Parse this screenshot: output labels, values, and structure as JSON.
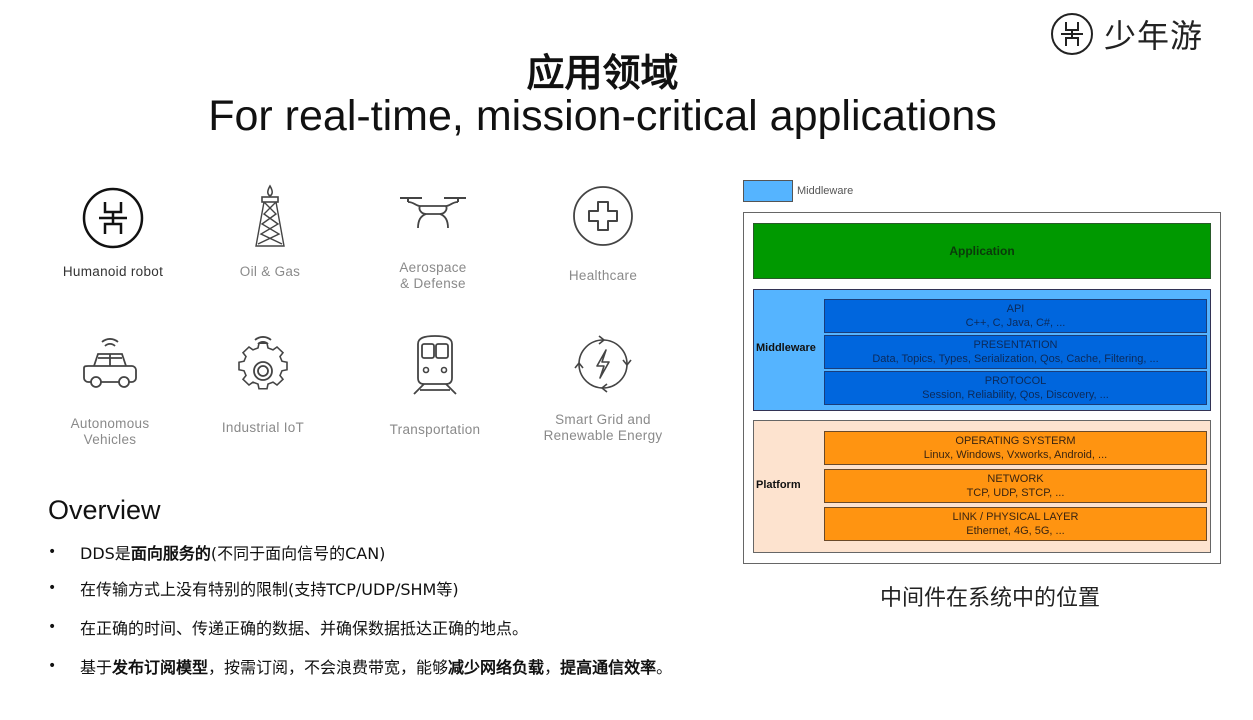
{
  "brand": {
    "logo_text": "少年游"
  },
  "header": {
    "title_cn": "应用领域",
    "title_en": "For real-time, mission-critical applications"
  },
  "applications": [
    {
      "label_line1": "Humanoid robot",
      "label_line2": "",
      "icon": "humanoid-robot-icon"
    },
    {
      "label_line1": "Oil & Gas",
      "label_line2": "",
      "icon": "oil-rig-icon"
    },
    {
      "label_line1": "Aerospace",
      "label_line2": "& Defense",
      "icon": "drone-icon"
    },
    {
      "label_line1": "Healthcare",
      "label_line2": "",
      "icon": "medical-cross-icon"
    },
    {
      "label_line1": "Autonomous",
      "label_line2": "Vehicles",
      "icon": "connected-car-icon"
    },
    {
      "label_line1": "Industrial IoT",
      "label_line2": "",
      "icon": "connected-gear-icon"
    },
    {
      "label_line1": "Transportation",
      "label_line2": "",
      "icon": "train-icon"
    },
    {
      "label_line1": "Smart Grid and",
      "label_line2": "Renewable Energy",
      "icon": "energy-cycle-icon"
    }
  ],
  "overview": {
    "title": "Overview",
    "bullets": [
      {
        "parts": [
          {
            "text": "DDS是",
            "bold": false
          },
          {
            "text": "面向服务的",
            "bold": true
          },
          {
            "text": "(不同于面向信号的CAN)",
            "bold": false
          }
        ]
      },
      {
        "parts": [
          {
            "text": "在传输方式上没有特别的限制(支持TCP/UDP/SHM等)",
            "bold": false
          }
        ]
      },
      {
        "parts": [
          {
            "text": "在正确的时间、传递正确的数据、并确保数据抵达正确的地点。",
            "bold": false
          }
        ]
      },
      {
        "parts": [
          {
            "text": "基于",
            "bold": false
          },
          {
            "text": "发布订阅模型",
            "bold": true
          },
          {
            "text": "，按需订阅，不会浪费带宽，能够",
            "bold": false
          },
          {
            "text": "减少网络负载",
            "bold": true
          },
          {
            "text": "，",
            "bold": false
          },
          {
            "text": "提高通信效率",
            "bold": true
          },
          {
            "text": "。",
            "bold": false
          }
        ]
      }
    ]
  },
  "diagram": {
    "legend_label": "Middleware",
    "application_label": "Application",
    "middleware_group_label": "Middleware",
    "middleware_layers": [
      {
        "title": "API",
        "detail": "C++,  C,  Java,  C#,  ..."
      },
      {
        "title": "PRESENTATION",
        "detail": "Data,  Topics,  Types,  Serialization,  Qos,  Cache,  Filtering,  ..."
      },
      {
        "title": "PROTOCOL",
        "detail": "Session,  Reliability,  Qos,  Discovery,  ..."
      }
    ],
    "platform_group_label": "Platform",
    "platform_layers": [
      {
        "title": "OPERATING SYSTERM",
        "detail": "Linux,  Windows,  Vxworks,  Android,  ..."
      },
      {
        "title": "NETWORK",
        "detail": "TCP,  UDP,  STCP,  ..."
      },
      {
        "title": "LINK / PHYSICAL LAYER",
        "detail": "Ethernet,  4G,  5G,  ..."
      }
    ],
    "colors": {
      "application": "#009900",
      "middleware_bg": "#55b4ff",
      "middleware_layer": "#0066dd",
      "platform_bg": "#fde3cf",
      "platform_layer": "#ff9411"
    },
    "caption": "中间件在系统中的位置"
  }
}
